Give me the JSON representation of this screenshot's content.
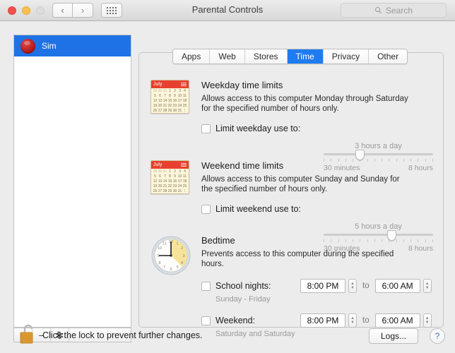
{
  "window": {
    "title": "Parental Controls",
    "traffic_lights": [
      "close",
      "minimize",
      "zoom"
    ],
    "nav": {
      "back": "‹",
      "forward": "›"
    },
    "grid_button": "all-preferences"
  },
  "search": {
    "placeholder": "Search"
  },
  "sidebar": {
    "users": [
      {
        "name": "Sim",
        "selected": true
      }
    ],
    "toolbar": {
      "add": "+",
      "remove": "−",
      "gear": "✻"
    }
  },
  "tabs": [
    {
      "label": "Apps",
      "active": false
    },
    {
      "label": "Web",
      "active": false
    },
    {
      "label": "Stores",
      "active": false
    },
    {
      "label": "Time",
      "active": true
    },
    {
      "label": "Privacy",
      "active": false
    },
    {
      "label": "Other",
      "active": false
    }
  ],
  "weekday": {
    "icon": "calendar-icon",
    "calendar_month": "July",
    "title": "Weekday time limits",
    "description": "Allows access to this computer Monday through Saturday for the specified number of hours only.",
    "checkbox_label": "Limit weekday use to:",
    "checked": false,
    "slider": {
      "value_label": "3 hours a day",
      "min_label": "30 minutes",
      "max_label": "8 hours",
      "position_percent": 33
    }
  },
  "weekend": {
    "icon": "calendar-icon",
    "calendar_month": "July",
    "title": "Weekend time limits",
    "description": "Allows access to this computer Sunday and Sunday for the specified number of hours only.",
    "checkbox_label": "Limit weekend use to:",
    "checked": false,
    "slider": {
      "value_label": "5 hours a day",
      "min_label": "30 minutes",
      "max_label": "8 hours",
      "position_percent": 62
    }
  },
  "bedtime": {
    "icon": "clock-icon",
    "title": "Bedtime",
    "description": "Prevents access to this computer during the specified hours.",
    "to_label": "to",
    "rows": [
      {
        "checkbox_label": "School nights:",
        "checked": false,
        "sub_label": "Sunday - Friday",
        "start_time": "8:00 PM",
        "end_time": "6:00 AM"
      },
      {
        "checkbox_label": "Weekend:",
        "checked": false,
        "sub_label": "Saturday and Saturday",
        "start_time": "8:00 PM",
        "end_time": "6:00 AM"
      }
    ]
  },
  "footer": {
    "lock_icon": "unlocked-padlock-icon",
    "lock_text": "Click the lock to prevent further changes.",
    "logs_label": "Logs...",
    "help_label": "?"
  },
  "colors": {
    "accent": "#1f7bf0",
    "selection": "#1f72e5",
    "calendar_header": "#e8402e",
    "lock": "#e09b33"
  },
  "calendar_rows": [
    [
      "29",
      "30",
      "31",
      "1",
      "2",
      "3",
      "4"
    ],
    [
      "5",
      "6",
      "7",
      "8",
      "9",
      "10",
      "11"
    ],
    [
      "12",
      "13",
      "14",
      "15",
      "16",
      "17",
      "18"
    ],
    [
      "19",
      "20",
      "21",
      "22",
      "23",
      "24",
      "25"
    ],
    [
      "26",
      "27",
      "28",
      "29",
      "30",
      "31",
      "1"
    ]
  ]
}
